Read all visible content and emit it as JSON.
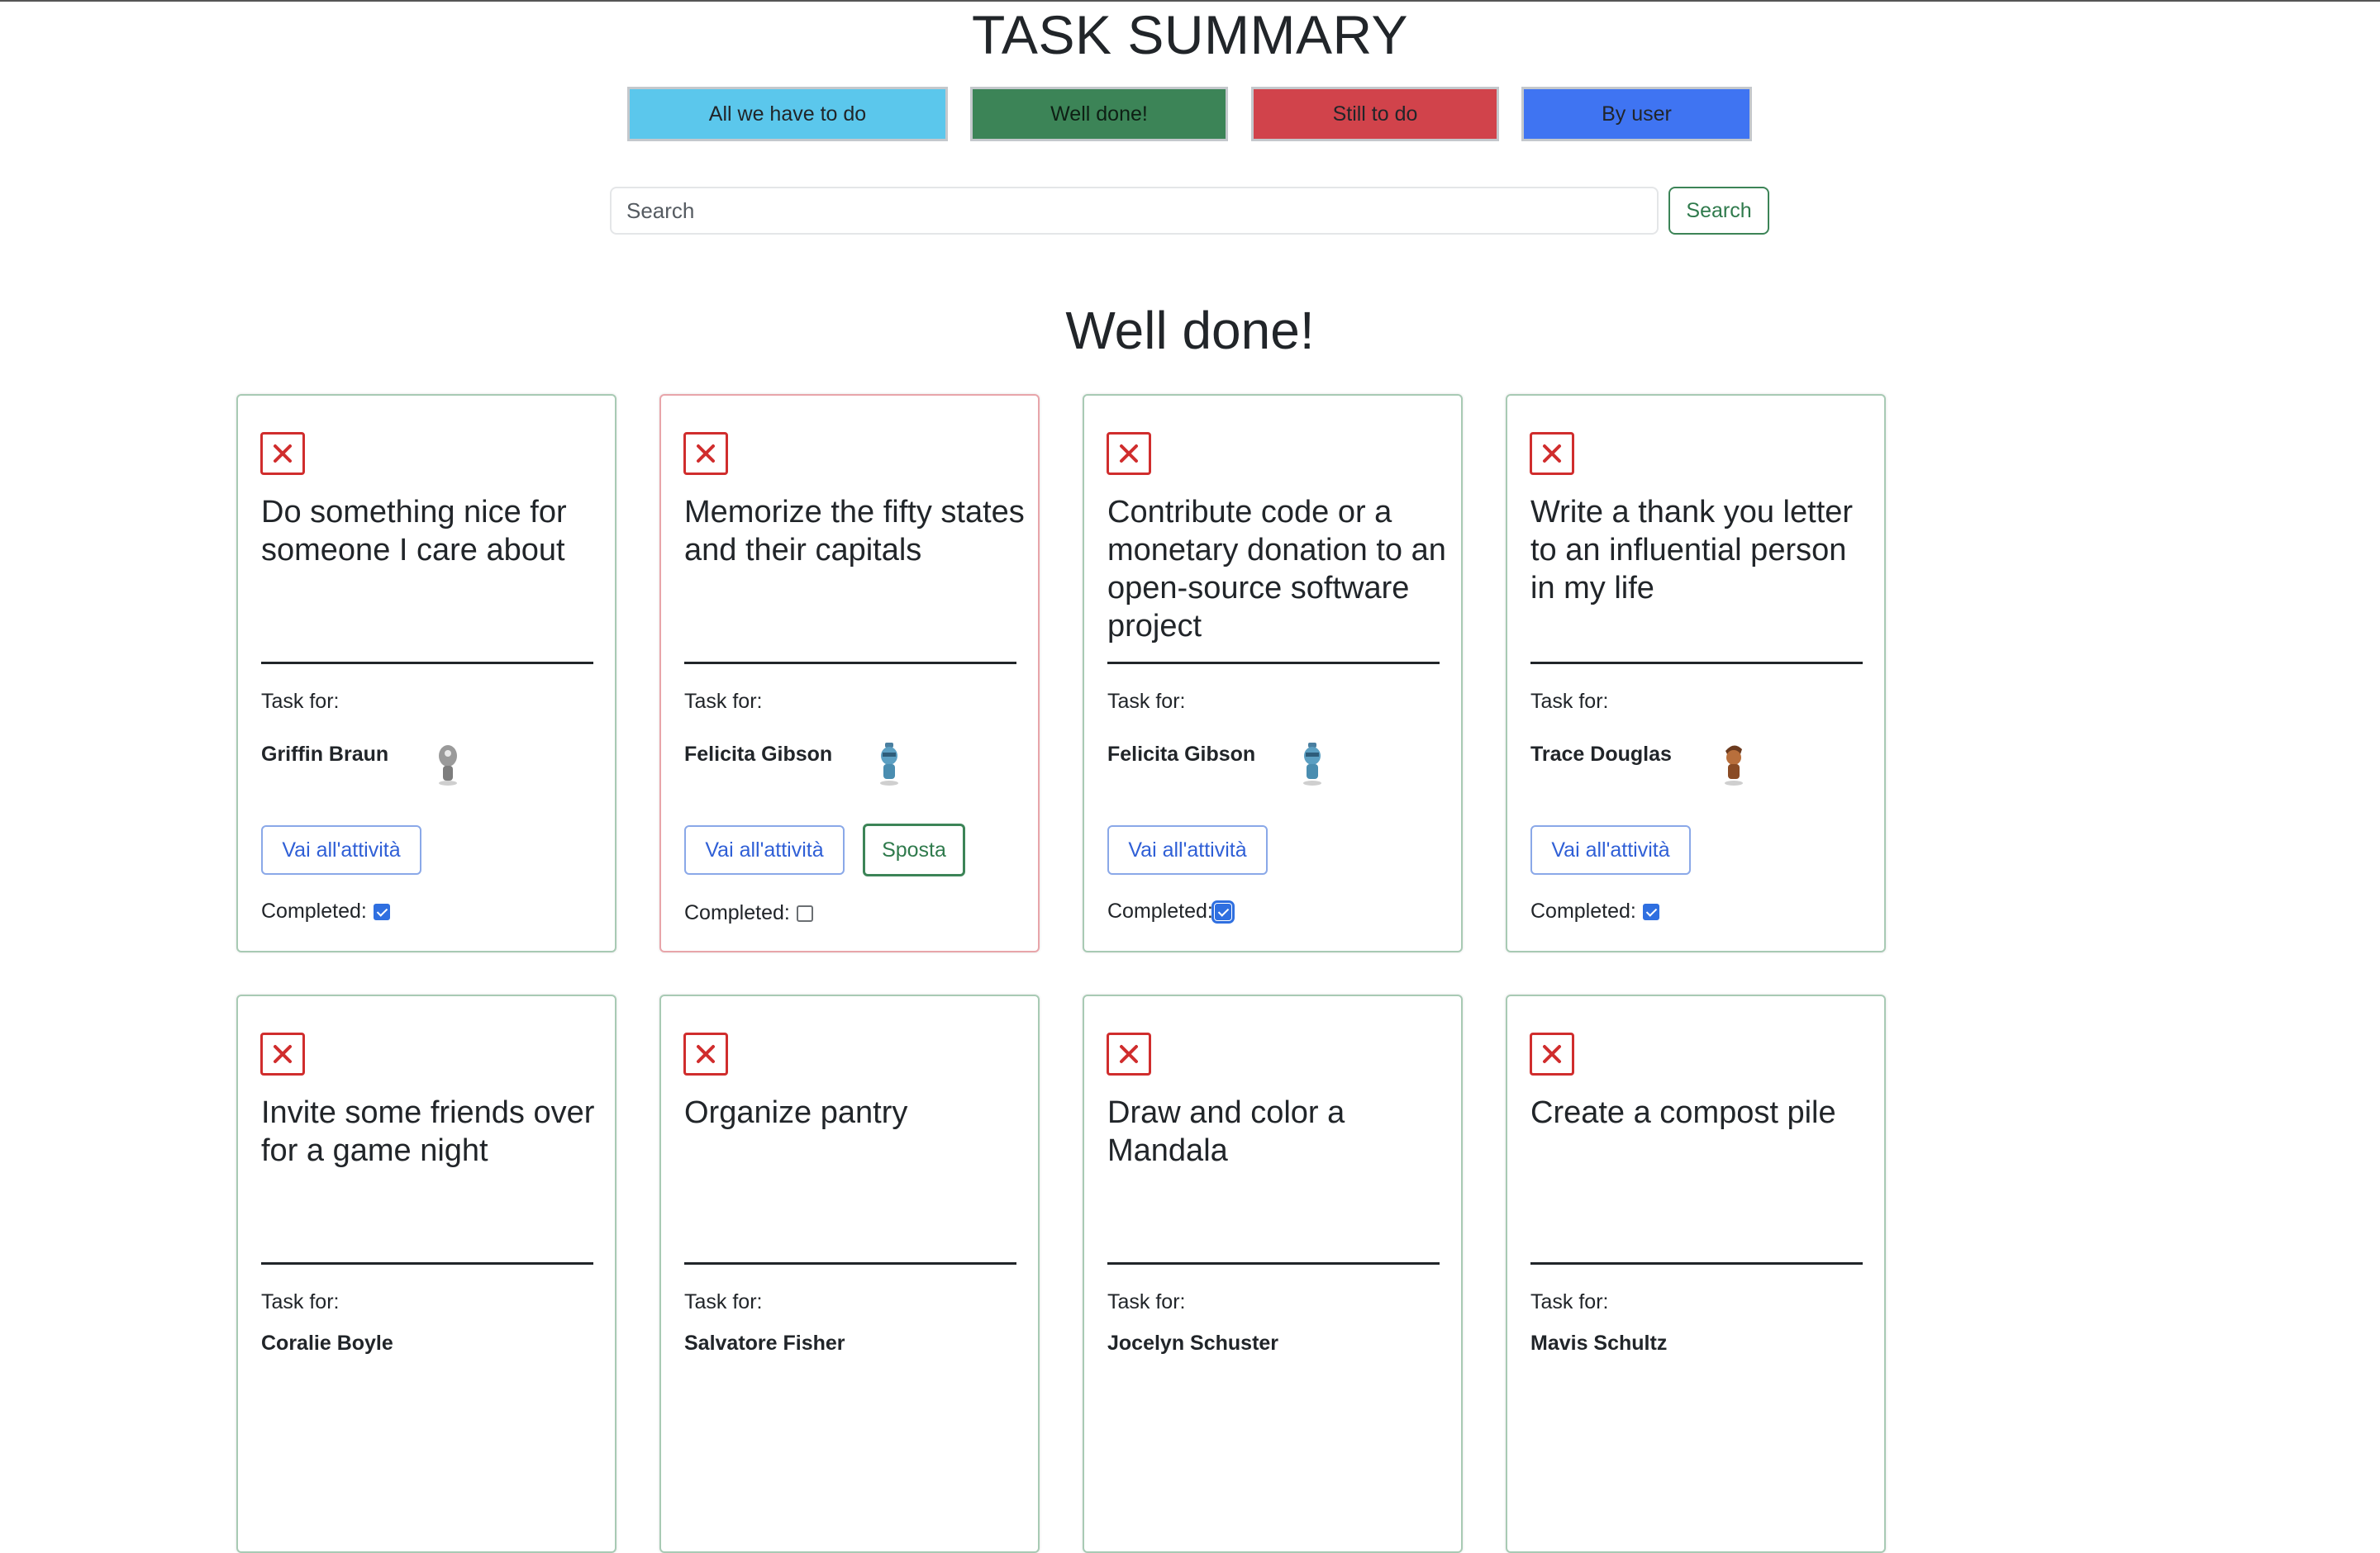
{
  "header": {
    "title": "TASK SUMMARY"
  },
  "filters": {
    "all": "All we have to do",
    "done": "Well done!",
    "todo": "Still to do",
    "by_user": "By user"
  },
  "search": {
    "placeholder": "Search",
    "button_label": "Search"
  },
  "section_heading": "Well done!",
  "labels": {
    "task_for": "Task for:",
    "go_to_activity": "Vai all'attività",
    "move": "Sposta",
    "completed": "Completed:"
  },
  "cards": [
    {
      "title": "Do something nice for someone I care about",
      "user": "Griffin Braun",
      "completed": true
    },
    {
      "title": "Memorize the fifty states and their capitals",
      "user": "Felicita Gibson",
      "completed": false
    },
    {
      "title": "Contribute code or a monetary donation to an open-source software project",
      "user": "Felicita Gibson",
      "completed": true
    },
    {
      "title": "Write a thank you letter to an influential person in my life",
      "user": "Trace Douglas",
      "completed": true
    },
    {
      "title": "Invite some friends over for a game night",
      "user": "Coralie Boyle"
    },
    {
      "title": "Organize pantry",
      "user": "Salvatore Fisher"
    },
    {
      "title": "Draw and color a Mandala",
      "user": "Jocelyn Schuster"
    },
    {
      "title": "Create a compost pile",
      "user": "Mavis Schultz"
    }
  ],
  "colors": {
    "filter_all": "#5bc7ec",
    "filter_done": "#3c8457",
    "filter_todo": "#d1434b",
    "filter_user": "#3f74f2",
    "delete_red": "#d02d2d"
  }
}
